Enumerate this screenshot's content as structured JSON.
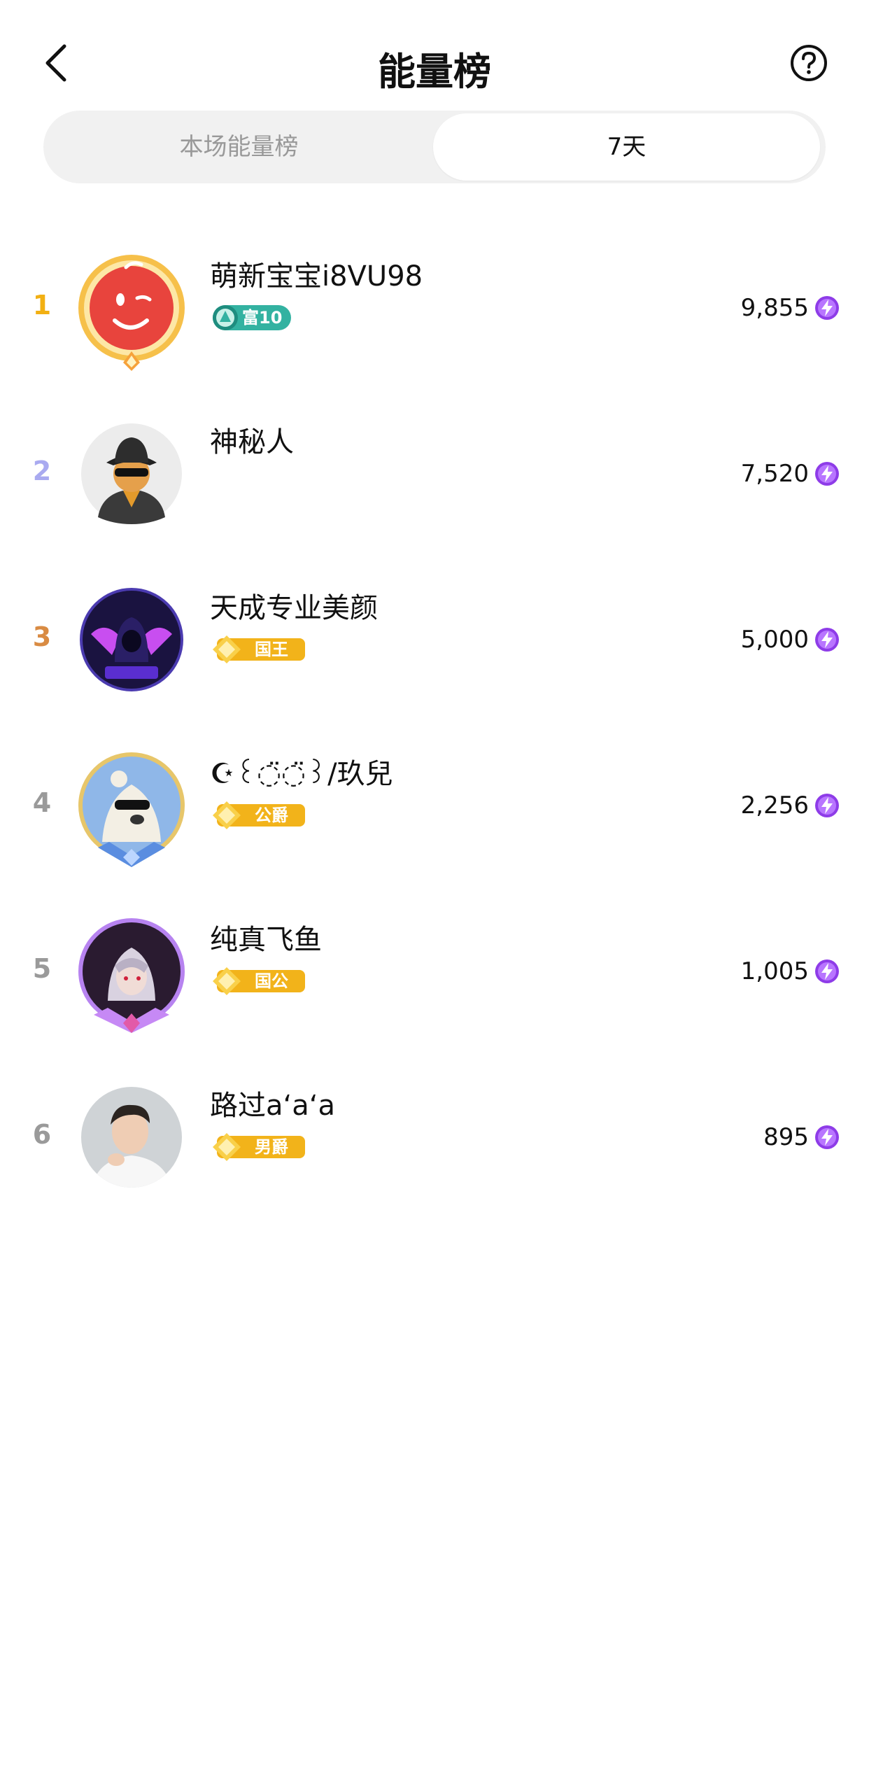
{
  "header": {
    "title": "能量榜"
  },
  "tabs": [
    {
      "label": "本场能量榜",
      "active": false
    },
    {
      "label": "7天",
      "active": true
    }
  ],
  "colors": {
    "rank1": "#f2b013",
    "rank2": "#a9aaf0",
    "rank3": "#d98b43",
    "rank_other": "#9a9a9a",
    "energy": "#8e3ce8",
    "badge_gold": "#f2b31a",
    "badge_teal": "#33b2a1"
  },
  "rows": [
    {
      "rank": "1",
      "name": "萌新宝宝i8VU98",
      "badge": "富10",
      "badge_type": "teal",
      "score": "9,855",
      "avatar_icon": "red-smile-avatar-icon"
    },
    {
      "rank": "2",
      "name": "神秘人",
      "badge": "",
      "badge_type": "none",
      "score": "7,520",
      "avatar_icon": "mystery-person-avatar-icon"
    },
    {
      "rank": "3",
      "name": "天成专业美颜",
      "badge": "国王",
      "badge_type": "gold",
      "score": "5,000",
      "avatar_icon": "neon-hood-avatar-icon"
    },
    {
      "rank": "4",
      "name": "☪꒰◌̈◌̈꒱/玖兒",
      "badge": "公爵",
      "badge_type": "gold",
      "score": "2,256",
      "avatar_icon": "bear-sunglasses-avatar-icon"
    },
    {
      "rank": "5",
      "name": "纯真飞鱼",
      "badge": "国公",
      "badge_type": "gold",
      "score": "1,005",
      "avatar_icon": "anime-character-avatar-icon"
    },
    {
      "rank": "6",
      "name": "路过aʻaʻa",
      "badge": "男爵",
      "badge_type": "gold",
      "score": "895",
      "avatar_icon": "man-photo-avatar-icon"
    }
  ]
}
